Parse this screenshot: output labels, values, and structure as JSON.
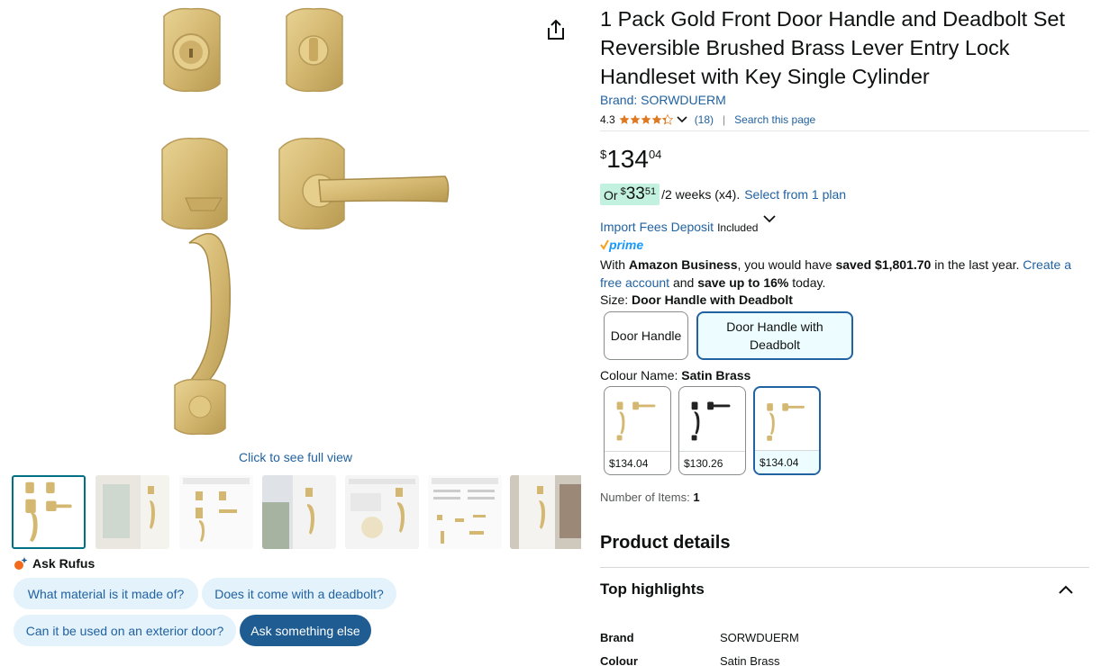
{
  "gallery": {
    "share_icon": "share-icon",
    "full_view": "Click to see full view",
    "thumbnail_count": 7
  },
  "rufus": {
    "label": "Ask Rufus",
    "chips": [
      "What material is it made of?",
      "Does it come with a deadbolt?",
      "Can it be used on an exterior door?",
      "Ask something else"
    ]
  },
  "product": {
    "title": "1 Pack Gold Front Door Handle and Deadbolt Set Reversible Brushed Brass Lever Entry Lock Handleset with Key Single Cylinder",
    "brand": "Brand: SORWDUERM",
    "rating": "4.3",
    "rating_count": "(18)",
    "search_page": "Search this page",
    "stars_value": 4.3
  },
  "price": {
    "symbol": "$",
    "whole": "134",
    "fraction": "04"
  },
  "installment": {
    "or": "Or",
    "symbol": "$",
    "whole": "33",
    "fraction": "51",
    "rest": "/2 weeks (x4).",
    "link": "Select from 1 plan"
  },
  "import": {
    "link": "Import Fees Deposit",
    "included": "Included"
  },
  "prime": "prime",
  "business": {
    "t1": "With ",
    "b1": "Amazon Business",
    "t2": ", you would have ",
    "b2": "saved $1,801.70",
    "t3": " in the last year. ",
    "link": "Create a free account",
    "t4": " and ",
    "b3": "save up to 16%",
    "t5": " today."
  },
  "size": {
    "label": "Size: ",
    "selected": "Door Handle with Deadbolt",
    "options": [
      "Door Handle",
      "Door Handle with Deadbolt"
    ]
  },
  "colour": {
    "label": "Colour Name: ",
    "selected": "Satin Brass",
    "swatches": [
      {
        "price": "$134.04",
        "color": "#d2b46c"
      },
      {
        "price": "$130.26",
        "color": "#222222"
      },
      {
        "price": "$134.04",
        "color": "#d2b46c"
      }
    ]
  },
  "items": {
    "label": "Number of Items: ",
    "value": "1"
  },
  "details": {
    "title": "Product details",
    "highlights": "Top highlights",
    "specs": [
      {
        "key": "Brand",
        "value": "SORWDUERM"
      },
      {
        "key": "Colour",
        "value": "Satin Brass"
      }
    ]
  },
  "colors": {
    "link": "#2162a1",
    "star": "#de7921",
    "brass": "#d4b871",
    "selected_border": "#2162a1",
    "chip_bg": "#e3f2fb"
  }
}
